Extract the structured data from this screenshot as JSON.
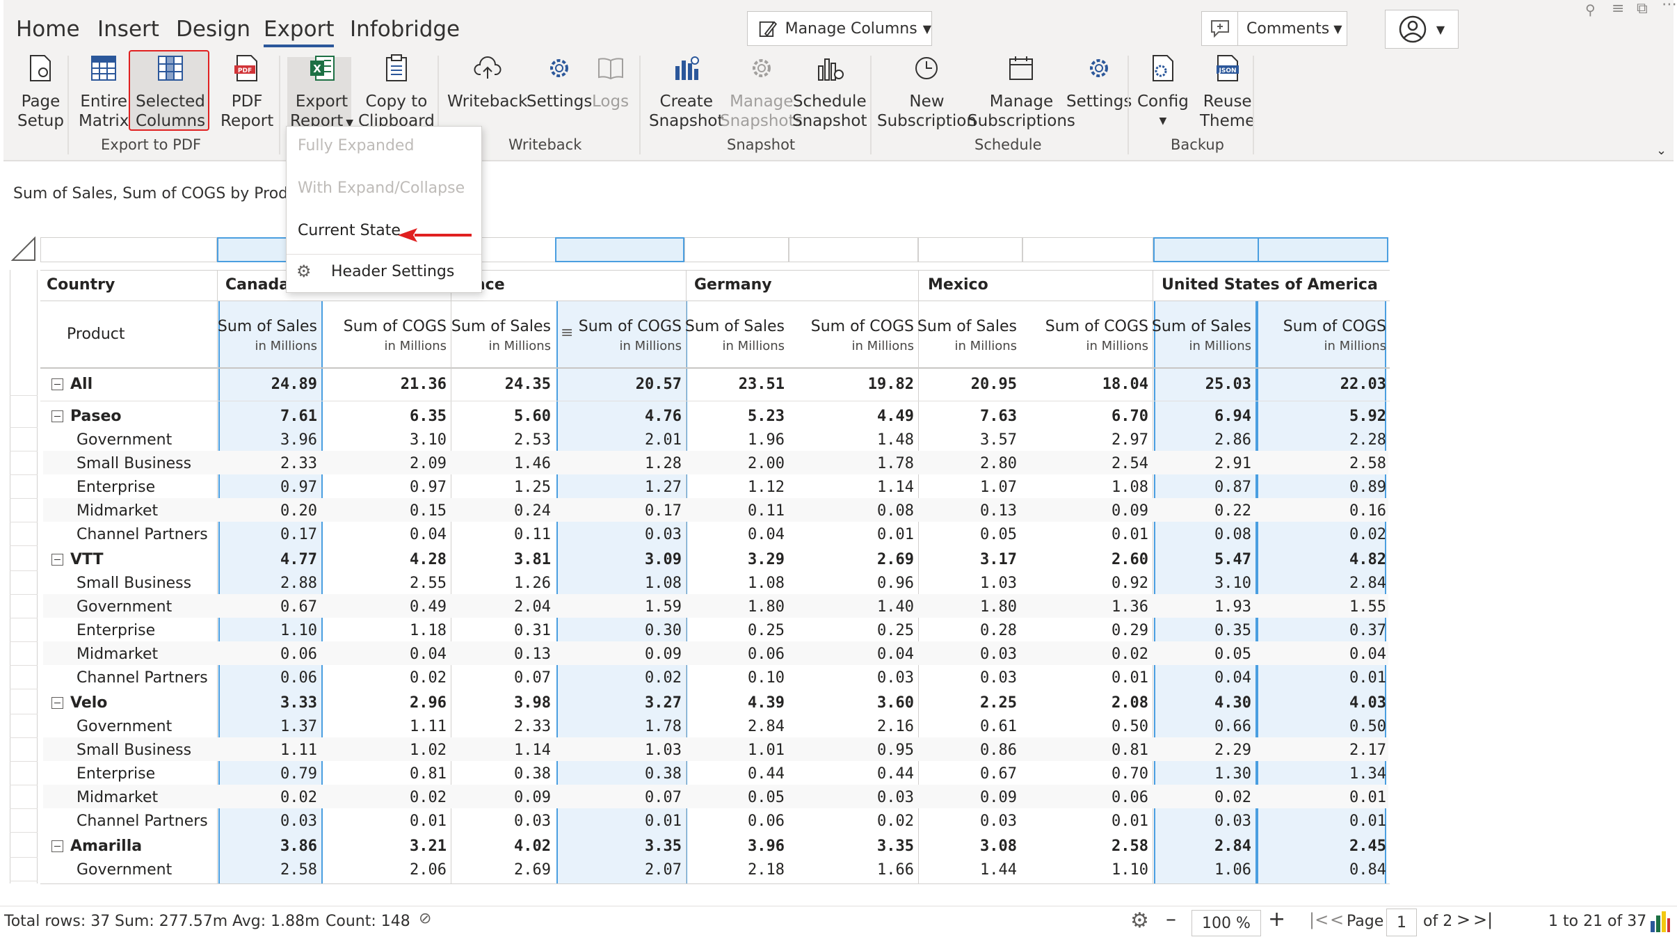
{
  "ribbon": {
    "tabs": [
      "Home",
      "Insert",
      "Design",
      "Export",
      "Infobridge"
    ],
    "active_tab": "Export",
    "manage_columns": "Manage Columns",
    "comments": "Comments",
    "buttons": {
      "page_setup": [
        "Page",
        "Setup"
      ],
      "entire_matrix": [
        "Entire",
        "Matrix"
      ],
      "selected_columns": [
        "Selected",
        "Columns"
      ],
      "pdf_report": [
        "PDF",
        "Report"
      ],
      "export_report": [
        "Export",
        "Report"
      ],
      "copy_clipboard": [
        "Copy to",
        "Clipboard"
      ],
      "writeback": "Writeback",
      "wb_settings": "Settings",
      "logs": "Logs",
      "create_snapshot": [
        "Create",
        "Snapshot"
      ],
      "manage_snapshots": [
        "Manage",
        "Snapshots"
      ],
      "schedule_snapshot": [
        "Schedule",
        "Snapshot"
      ],
      "new_subscription": [
        "New",
        "Subscription"
      ],
      "manage_subscriptions": [
        "Manage",
        "Subscriptions"
      ],
      "sch_settings": "Settings",
      "config": "Config",
      "reuse_theme": [
        "Reuse",
        "Theme"
      ]
    },
    "groups": [
      "Export to PDF",
      "Writeback",
      "Snapshot",
      "Schedule",
      "Backup"
    ]
  },
  "dropdown": {
    "items": [
      "Fully Expanded",
      "With Expand/Collapse",
      "Current State",
      "Header Settings"
    ]
  },
  "subtitle": "Sum of Sales, Sum of COGS by Product,",
  "table": {
    "country_header": "Country",
    "product_header": "Product",
    "countries": [
      "Canada",
      "nce",
      "Germany",
      "Mexico",
      "United States of America"
    ],
    "measure": [
      "Sum of Sales",
      "Sum of COGS"
    ],
    "unit": "in Millions",
    "rows": [
      {
        "label": "All",
        "level": 0,
        "bold": true,
        "toggle": true,
        "v": [
          "24.89",
          "21.36",
          "24.35",
          "20.57",
          "23.51",
          "19.82",
          "20.95",
          "18.04",
          "25.03",
          "22.03"
        ]
      },
      {
        "label": "Paseo",
        "level": 0,
        "bold": true,
        "toggle": true,
        "v": [
          "7.61",
          "6.35",
          "5.60",
          "4.76",
          "5.23",
          "4.49",
          "7.63",
          "6.70",
          "6.94",
          "5.92"
        ]
      },
      {
        "label": "Government",
        "level": 1,
        "v": [
          "3.96",
          "3.10",
          "2.53",
          "2.01",
          "1.96",
          "1.48",
          "3.57",
          "2.97",
          "2.86",
          "2.28"
        ]
      },
      {
        "label": "Small Business",
        "level": 1,
        "v": [
          "2.33",
          "2.09",
          "1.46",
          "1.28",
          "2.00",
          "1.78",
          "2.80",
          "2.54",
          "2.91",
          "2.58"
        ]
      },
      {
        "label": "Enterprise",
        "level": 1,
        "v": [
          "0.97",
          "0.97",
          "1.25",
          "1.27",
          "1.12",
          "1.14",
          "1.07",
          "1.08",
          "0.87",
          "0.89"
        ]
      },
      {
        "label": "Midmarket",
        "level": 1,
        "v": [
          "0.20",
          "0.15",
          "0.24",
          "0.17",
          "0.11",
          "0.08",
          "0.13",
          "0.09",
          "0.22",
          "0.16"
        ]
      },
      {
        "label": "Channel Partners",
        "level": 1,
        "v": [
          "0.17",
          "0.04",
          "0.11",
          "0.03",
          "0.04",
          "0.01",
          "0.05",
          "0.01",
          "0.08",
          "0.02"
        ]
      },
      {
        "label": "VTT",
        "level": 0,
        "bold": true,
        "toggle": true,
        "v": [
          "4.77",
          "4.28",
          "3.81",
          "3.09",
          "3.29",
          "2.69",
          "3.17",
          "2.60",
          "5.47",
          "4.82"
        ]
      },
      {
        "label": "Small Business",
        "level": 1,
        "v": [
          "2.88",
          "2.55",
          "1.26",
          "1.08",
          "1.08",
          "0.96",
          "1.03",
          "0.92",
          "3.10",
          "2.84"
        ]
      },
      {
        "label": "Government",
        "level": 1,
        "v": [
          "0.67",
          "0.49",
          "2.04",
          "1.59",
          "1.80",
          "1.40",
          "1.80",
          "1.36",
          "1.93",
          "1.55"
        ]
      },
      {
        "label": "Enterprise",
        "level": 1,
        "v": [
          "1.10",
          "1.18",
          "0.31",
          "0.30",
          "0.25",
          "0.25",
          "0.28",
          "0.29",
          "0.35",
          "0.37"
        ]
      },
      {
        "label": "Midmarket",
        "level": 1,
        "v": [
          "0.06",
          "0.04",
          "0.13",
          "0.09",
          "0.06",
          "0.04",
          "0.03",
          "0.02",
          "0.05",
          "0.04"
        ]
      },
      {
        "label": "Channel Partners",
        "level": 1,
        "v": [
          "0.06",
          "0.02",
          "0.07",
          "0.02",
          "0.10",
          "0.03",
          "0.03",
          "0.01",
          "0.04",
          "0.01"
        ]
      },
      {
        "label": "Velo",
        "level": 0,
        "bold": true,
        "toggle": true,
        "v": [
          "3.33",
          "2.96",
          "3.98",
          "3.27",
          "4.39",
          "3.60",
          "2.25",
          "2.08",
          "4.30",
          "4.03"
        ]
      },
      {
        "label": "Government",
        "level": 1,
        "v": [
          "1.37",
          "1.11",
          "2.33",
          "1.78",
          "2.84",
          "2.16",
          "0.61",
          "0.50",
          "0.66",
          "0.50"
        ]
      },
      {
        "label": "Small Business",
        "level": 1,
        "v": [
          "1.11",
          "1.02",
          "1.14",
          "1.03",
          "1.01",
          "0.95",
          "0.86",
          "0.81",
          "2.29",
          "2.17"
        ]
      },
      {
        "label": "Enterprise",
        "level": 1,
        "v": [
          "0.79",
          "0.81",
          "0.38",
          "0.38",
          "0.44",
          "0.44",
          "0.67",
          "0.70",
          "1.30",
          "1.34"
        ]
      },
      {
        "label": "Midmarket",
        "level": 1,
        "v": [
          "0.02",
          "0.02",
          "0.09",
          "0.07",
          "0.05",
          "0.03",
          "0.09",
          "0.06",
          "0.02",
          "0.01"
        ]
      },
      {
        "label": "Channel Partners",
        "level": 1,
        "v": [
          "0.03",
          "0.01",
          "0.03",
          "0.01",
          "0.06",
          "0.02",
          "0.03",
          "0.01",
          "0.03",
          "0.01"
        ]
      },
      {
        "label": "Amarilla",
        "level": 0,
        "bold": true,
        "toggle": true,
        "v": [
          "3.86",
          "3.21",
          "4.02",
          "3.35",
          "3.96",
          "3.35",
          "3.08",
          "2.58",
          "2.84",
          "2.45"
        ]
      },
      {
        "label": "Government",
        "level": 1,
        "v": [
          "2.58",
          "2.06",
          "2.69",
          "2.07",
          "2.18",
          "1.66",
          "1.44",
          "1.10",
          "1.06",
          "0.84"
        ]
      }
    ]
  },
  "footer": {
    "total_rows": "Total rows: 37",
    "sum": "Sum: 277.57m",
    "avg": "Avg: 1.88m",
    "count": "Count: 148",
    "zoom": "100 %",
    "page_label": "Page",
    "page_value": "1",
    "of_pages": "of 2",
    "range": "1 to 21 of 37"
  },
  "colors": {
    "accent": "#2b579a",
    "selection": "#4a9ee0",
    "arrow": "#e02020",
    "excel": "#1d7044",
    "pdf": "#d13438"
  }
}
